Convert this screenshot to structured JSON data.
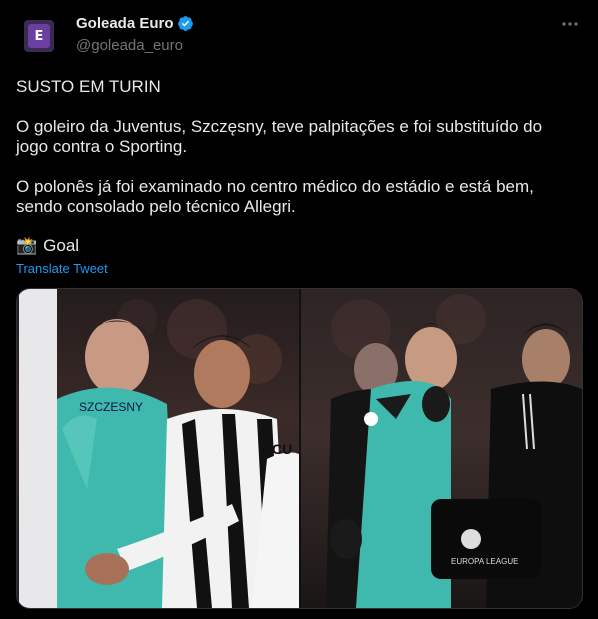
{
  "account": {
    "display_name": "Goleada Euro",
    "handle": "@goleada_euro",
    "avatar_letter": "E"
  },
  "tweet": {
    "line1": "SUSTO EM TURIN",
    "line2": "O goleiro da Juventus, Szczęsny, teve palpitações e foi substituído do jogo contra o Sporting.",
    "line3": "O polonês já foi examinado no centro médico do estádio e está bem, sendo consolado pelo técnico Allegri.",
    "credit_emoji": "📸",
    "credit": "Goal",
    "translate_label": "Translate Tweet"
  },
  "images": {
    "left": {
      "shirt_text": "SZCZESNY",
      "opponent_shirt_text": "CU"
    },
    "right": {
      "bag_text": "EUROPA LEAGUE"
    }
  },
  "colors": {
    "background": "#000000",
    "text": "#e7e9ea",
    "muted": "#71767b",
    "link": "#1d9bf0",
    "verified": "#1d9bf0",
    "keeper_kit": "#3fb9ad"
  },
  "icons": [
    "verified-badge-icon",
    "more-options-icon",
    "camera-icon"
  ]
}
